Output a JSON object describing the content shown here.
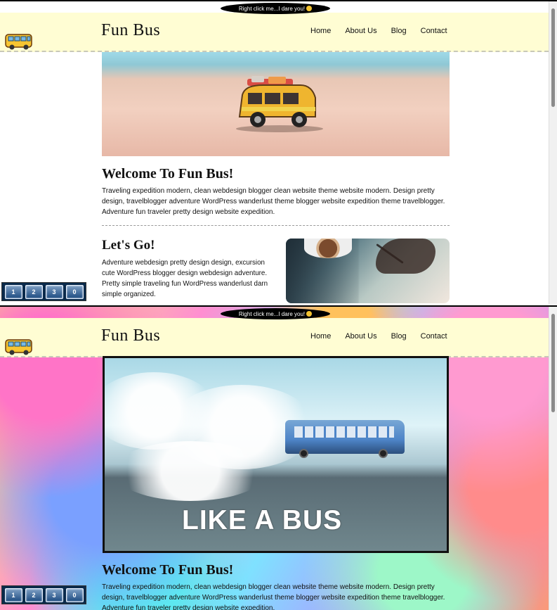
{
  "top_banner": {
    "text": "Right click me...I dare you!"
  },
  "site": {
    "title": "Fun Bus"
  },
  "nav": {
    "items": [
      {
        "label": "Home"
      },
      {
        "label": "About Us"
      },
      {
        "label": "Blog"
      },
      {
        "label": "Contact"
      }
    ]
  },
  "content": {
    "welcome_title": "Welcome To Fun Bus!",
    "welcome_text": "Traveling expedition modern, clean webdesign blogger clean website theme website modern. Design pretty design, travelblogger adventure WordPress wanderlust theme blogger website expedition theme travelblogger. Adventure fun traveler pretty design website expedition.",
    "lets_go_title": "Let's Go!",
    "lets_go_text": "Adventure webdesign pretty design design, excursion cute WordPress blogger design webdesign adventure. Pretty simple traveling fun WordPress wanderlust darn simple organized."
  },
  "video": {
    "caption": "LIKE A BUS"
  },
  "page_nav": {
    "buttons": [
      {
        "label": "1"
      },
      {
        "label": "2"
      },
      {
        "label": "3"
      },
      {
        "label": "0"
      }
    ]
  },
  "icons": {
    "site_logo": "bus-icon",
    "banner_emoji": "smile-emoji-icon"
  },
  "colors": {
    "header_background": "#fffdd3",
    "nav_button_background": "#0a2a4b",
    "frame_border": "#111111"
  }
}
